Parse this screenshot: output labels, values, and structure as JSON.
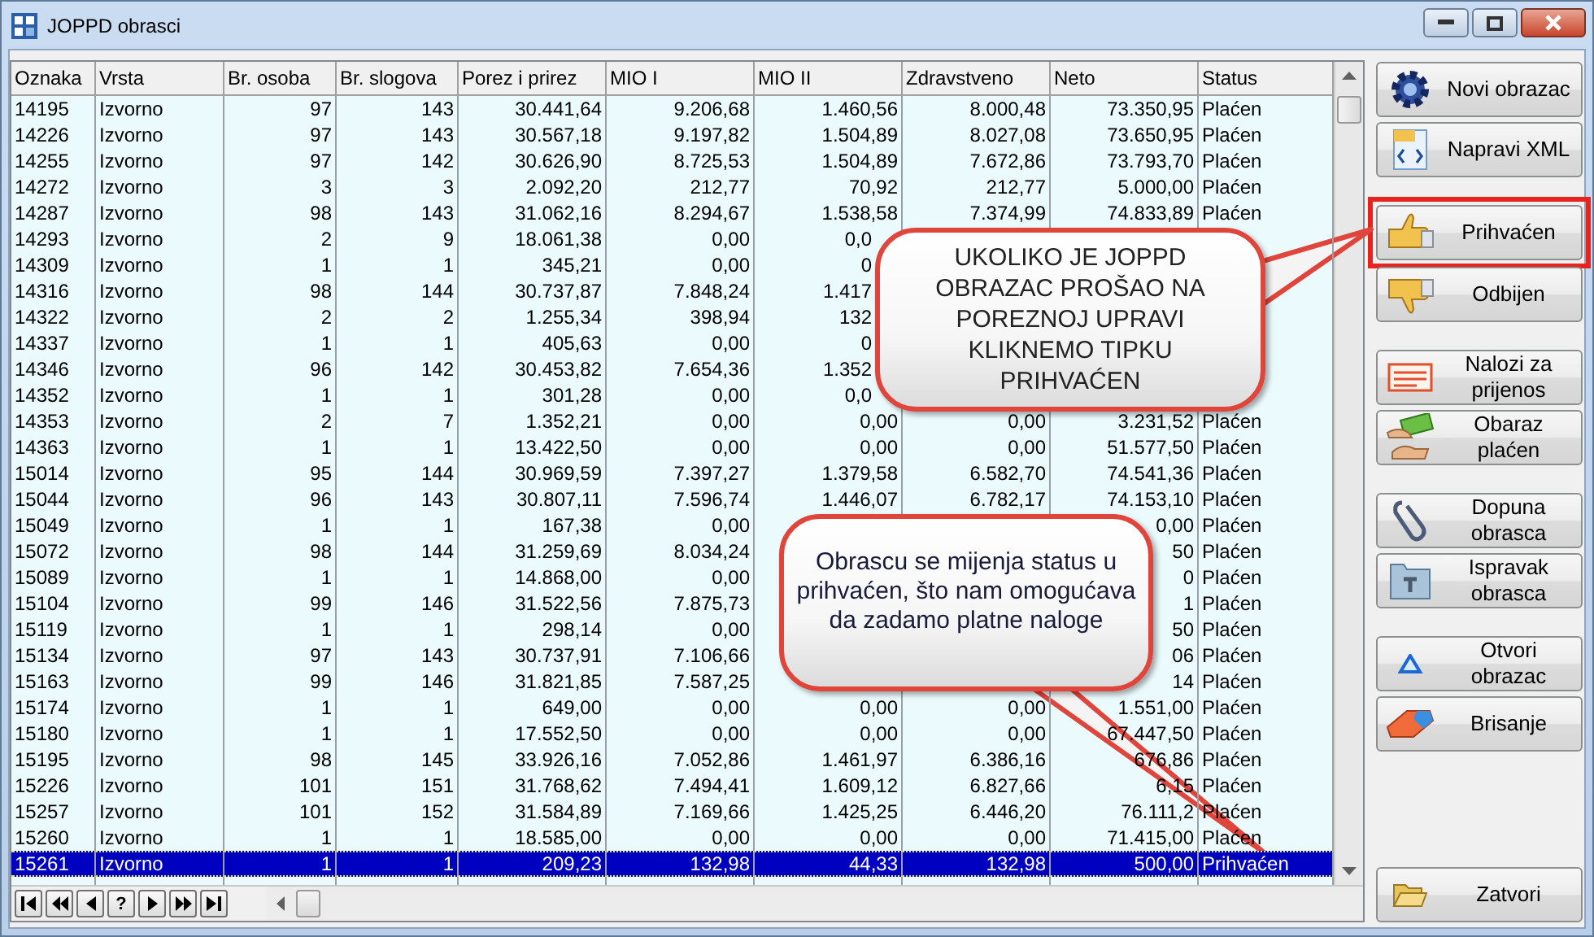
{
  "window": {
    "title": "JOPPD obrasci"
  },
  "table": {
    "columns": [
      "Oznaka",
      "Vrsta",
      "Br. osoba",
      "Br. slogova",
      "Porez i prirez",
      "MIO I",
      "MIO II",
      "Zdravstveno",
      "Neto",
      "Status"
    ],
    "rows": [
      {
        "selected": false,
        "cells": [
          "14195",
          "Izvorno",
          "97",
          "143",
          "30.441,64",
          "9.206,68",
          "1.460,56",
          "8.000,48",
          "73.350,95",
          "Plaćen"
        ]
      },
      {
        "selected": false,
        "cells": [
          "14226",
          "Izvorno",
          "97",
          "143",
          "30.567,18",
          "9.197,82",
          "1.504,89",
          "8.027,08",
          "73.650,95",
          "Plaćen"
        ]
      },
      {
        "selected": false,
        "cells": [
          "14255",
          "Izvorno",
          "97",
          "142",
          "30.626,90",
          "8.725,53",
          "1.504,89",
          "7.672,86",
          "73.793,70",
          "Plaćen"
        ]
      },
      {
        "selected": false,
        "cells": [
          "14272",
          "Izvorno",
          "3",
          "3",
          "2.092,20",
          "212,77",
          "70,92",
          "212,77",
          "5.000,00",
          "Plaćen"
        ]
      },
      {
        "selected": false,
        "cells": [
          "14287",
          "Izvorno",
          "98",
          "143",
          "31.062,16",
          "8.294,67",
          "1.538,58",
          "7.374,99",
          "74.833,89",
          "Plaćen"
        ]
      },
      {
        "selected": false,
        "cells": [
          "14293",
          "Izvorno",
          "2",
          "9",
          "18.061,38",
          "0,00",
          "0,0",
          null,
          null,
          null
        ]
      },
      {
        "selected": false,
        "cells": [
          "14309",
          "Izvorno",
          "1",
          "1",
          "345,21",
          "0,00",
          "0",
          null,
          null,
          null
        ]
      },
      {
        "selected": false,
        "cells": [
          "14316",
          "Izvorno",
          "98",
          "144",
          "30.737,87",
          "7.848,24",
          "1.417",
          null,
          null,
          null
        ]
      },
      {
        "selected": false,
        "cells": [
          "14322",
          "Izvorno",
          "2",
          "2",
          "1.255,34",
          "398,94",
          "132",
          null,
          null,
          null
        ]
      },
      {
        "selected": false,
        "cells": [
          "14337",
          "Izvorno",
          "1",
          "1",
          "405,63",
          "0,00",
          "0",
          null,
          null,
          null
        ]
      },
      {
        "selected": false,
        "cells": [
          "14346",
          "Izvorno",
          "96",
          "142",
          "30.453,82",
          "7.654,36",
          "1.352",
          null,
          null,
          null
        ]
      },
      {
        "selected": false,
        "cells": [
          "14352",
          "Izvorno",
          "1",
          "1",
          "301,28",
          "0,00",
          "0,0",
          null,
          null,
          null
        ]
      },
      {
        "selected": false,
        "cells": [
          "14353",
          "Izvorno",
          "2",
          "7",
          "1.352,21",
          "0,00",
          "0,00",
          "0,00",
          "3.231,52",
          "Plaćen"
        ]
      },
      {
        "selected": false,
        "cells": [
          "14363",
          "Izvorno",
          "1",
          "1",
          "13.422,50",
          "0,00",
          "0,00",
          "0,00",
          "51.577,50",
          "Plaćen"
        ]
      },
      {
        "selected": false,
        "cells": [
          "15014",
          "Izvorno",
          "95",
          "144",
          "30.969,59",
          "7.397,27",
          "1.379,58",
          "6.582,70",
          "74.541,36",
          "Plaćen"
        ]
      },
      {
        "selected": false,
        "cells": [
          "15044",
          "Izvorno",
          "96",
          "143",
          "30.807,11",
          "7.596,74",
          "1.446,07",
          "6.782,17",
          "74.153,10",
          "Plaćen"
        ]
      },
      {
        "selected": false,
        "cells": [
          "15049",
          "Izvorno",
          "1",
          "1",
          "167,38",
          "0,00",
          null,
          null,
          "0,00",
          "Plaćen"
        ]
      },
      {
        "selected": false,
        "cells": [
          "15072",
          "Izvorno",
          "98",
          "144",
          "31.259,69",
          "8.034,24",
          null,
          null,
          "50",
          "Plaćen"
        ]
      },
      {
        "selected": false,
        "cells": [
          "15089",
          "Izvorno",
          "1",
          "1",
          "14.868,00",
          "0,00",
          null,
          null,
          "0",
          "Plaćen"
        ]
      },
      {
        "selected": false,
        "cells": [
          "15104",
          "Izvorno",
          "99",
          "146",
          "31.522,56",
          "7.875,73",
          null,
          null,
          "1",
          "Plaćen"
        ]
      },
      {
        "selected": false,
        "cells": [
          "15119",
          "Izvorno",
          "1",
          "1",
          "298,14",
          "0,00",
          null,
          null,
          "50",
          "Plaćen"
        ]
      },
      {
        "selected": false,
        "cells": [
          "15134",
          "Izvorno",
          "97",
          "143",
          "30.737,91",
          "7.106,66",
          null,
          null,
          "06",
          "Plaćen"
        ]
      },
      {
        "selected": false,
        "cells": [
          "15163",
          "Izvorno",
          "99",
          "146",
          "31.821,85",
          "7.587,25",
          null,
          null,
          "14",
          "Plaćen"
        ]
      },
      {
        "selected": false,
        "cells": [
          "15174",
          "Izvorno",
          "1",
          "1",
          "649,00",
          "0,00",
          "0,00",
          "0,00",
          "1.551,00",
          "Plaćen"
        ]
      },
      {
        "selected": false,
        "cells": [
          "15180",
          "Izvorno",
          "1",
          "1",
          "17.552,50",
          "0,00",
          "0,00",
          "0,00",
          "67.447,50",
          "Plaćen"
        ]
      },
      {
        "selected": false,
        "cells": [
          "15195",
          "Izvorno",
          "98",
          "145",
          "33.926,16",
          "7.052,86",
          "1.461,97",
          "6.386,16",
          "676,86",
          "Plaćen"
        ]
      },
      {
        "selected": false,
        "cells": [
          "15226",
          "Izvorno",
          "101",
          "151",
          "31.768,62",
          "7.494,41",
          "1.609,12",
          "6.827,66",
          "6,15",
          "Plaćen"
        ]
      },
      {
        "selected": false,
        "cells": [
          "15257",
          "Izvorno",
          "101",
          "152",
          "31.584,89",
          "7.169,66",
          "1.425,25",
          "6.446,20",
          "76.111,2",
          "Plaćen"
        ]
      },
      {
        "selected": false,
        "cells": [
          "15260",
          "Izvorno",
          "1",
          "1",
          "18.585,00",
          "0,00",
          "0,00",
          "0,00",
          "71.415,00",
          "Plaćen"
        ]
      },
      {
        "selected": true,
        "cells": [
          "15261",
          "Izvorno",
          "1",
          "1",
          "209,23",
          "132,98",
          "44,33",
          "132,98",
          "500,00",
          "Prihvaćen"
        ]
      }
    ]
  },
  "navigator": {
    "help_label": "?"
  },
  "button_groups": [
    {
      "buttons": [
        {
          "label": "Novi obrazac",
          "highlighted": false
        },
        {
          "label": "Napravi XML",
          "highlighted": false
        }
      ]
    },
    {
      "buttons": [
        {
          "label": "Prihvaćen",
          "highlighted": true
        },
        {
          "label": "Odbijen",
          "highlighted": false
        }
      ]
    },
    {
      "buttons": [
        {
          "label": "Nalozi za prijenos",
          "highlighted": false
        },
        {
          "label": "Obaraz plaćen",
          "highlighted": false
        }
      ]
    },
    {
      "buttons": [
        {
          "label": "Dopuna obrasca",
          "highlighted": false
        },
        {
          "label": "Ispravak obrasca",
          "highlighted": false
        }
      ]
    },
    {
      "buttons": [
        {
          "label": "Otvori obrazac",
          "highlighted": false
        },
        {
          "label": "Brisanje",
          "highlighted": false
        }
      ]
    },
    {
      "buttons": [
        {
          "label": "Zatvori",
          "highlighted": false
        }
      ]
    }
  ],
  "callouts": [
    {
      "text": "UKOLIKO JE JOPPD OBRAZAC PROŠAO NA POREZNOJ UPRAVI KLIKNEMO TIPKU PRIHVAĆEN"
    },
    {
      "text": "Obrascu se mijenja status u prihvaćen, što nam omogućava da zadamo platne naloge"
    }
  ]
}
